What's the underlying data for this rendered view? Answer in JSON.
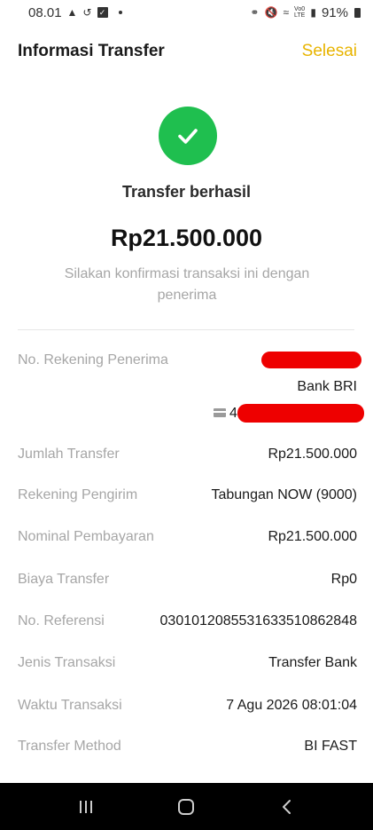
{
  "status_bar": {
    "time": "08.01",
    "battery": "91%",
    "lte_line1": "Vo0",
    "lte_line2": "LTE"
  },
  "header": {
    "title": "Informasi Transfer",
    "done_label": "Selesai"
  },
  "result": {
    "title": "Transfer berhasil",
    "amount": "Rp21.500.000",
    "subtitle": "Silakan konfirmasi transaksi ini dengan penerima"
  },
  "recipient": {
    "label": "No. Rekening Penerima",
    "bank": "Bank BRI",
    "account_prefix": "4"
  },
  "details": [
    {
      "label": "Jumlah Transfer",
      "value": "Rp21.500.000"
    },
    {
      "label": "Rekening Pengirim",
      "value": "Tabungan NOW (9000)"
    },
    {
      "label": "Nominal Pembayaran",
      "value": "Rp21.500.000"
    },
    {
      "label": "Biaya Transfer",
      "value": "Rp0"
    },
    {
      "label": "No. Referensi",
      "value": "030101208553163351086284​8"
    },
    {
      "label": "Jenis Transaksi",
      "value": "Transfer Bank"
    },
    {
      "label": "Waktu Transaksi",
      "value": "7 Agu 2026 08:01:04"
    },
    {
      "label": "Transfer Method",
      "value": "BI FAST"
    }
  ],
  "colors": {
    "accent": "#e8b400",
    "success": "#1fbf4f",
    "redaction": "#ee0000"
  },
  "icons": [
    "check-icon",
    "card-icon",
    "recent-apps-icon",
    "home-icon",
    "back-icon"
  ]
}
